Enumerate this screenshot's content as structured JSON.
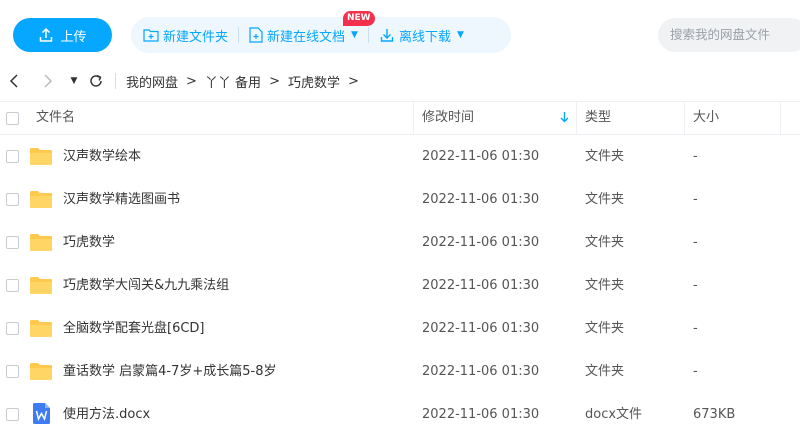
{
  "toolbar": {
    "upload_label": "上传",
    "new_folder_label": "新建文件夹",
    "new_online_doc_label": "新建在线文档",
    "new_badge": "NEW",
    "offline_download_label": "离线下载",
    "search_placeholder": "搜索我的网盘文件"
  },
  "breadcrumb": {
    "items": [
      "我的网盘",
      "丫丫 备用",
      "巧虎数学"
    ]
  },
  "table": {
    "headers": {
      "name": "文件名",
      "modified": "修改时间",
      "type": "类型",
      "size": "大小"
    },
    "rows": [
      {
        "name": "汉声数学绘本",
        "modified": "2022-11-06 01:30",
        "type": "文件夹",
        "size": "-",
        "icon": "folder-icon"
      },
      {
        "name": "汉声数学精选图画书",
        "modified": "2022-11-06 01:30",
        "type": "文件夹",
        "size": "-",
        "icon": "folder-icon"
      },
      {
        "name": "巧虎数学",
        "modified": "2022-11-06 01:30",
        "type": "文件夹",
        "size": "-",
        "icon": "folder-icon"
      },
      {
        "name": "巧虎数学大闯关&九九乘法组",
        "modified": "2022-11-06 01:30",
        "type": "文件夹",
        "size": "-",
        "icon": "folder-icon"
      },
      {
        "name": "全脑数学配套光盘[6CD]",
        "modified": "2022-11-06 01:30",
        "type": "文件夹",
        "size": "-",
        "icon": "folder-icon"
      },
      {
        "name": "童话数学 启蒙篇4-7岁+成长篇5-8岁",
        "modified": "2022-11-06 01:30",
        "type": "文件夹",
        "size": "-",
        "icon": "folder-icon"
      },
      {
        "name": "使用方法.docx",
        "modified": "2022-11-06 01:30",
        "type": "docx文件",
        "size": "673KB",
        "icon": "word-doc-icon"
      }
    ]
  },
  "colors": {
    "accent": "#06a7ff",
    "folder": "#ffc94d",
    "badge": "#f5304c",
    "word": "#3d7cf2"
  }
}
